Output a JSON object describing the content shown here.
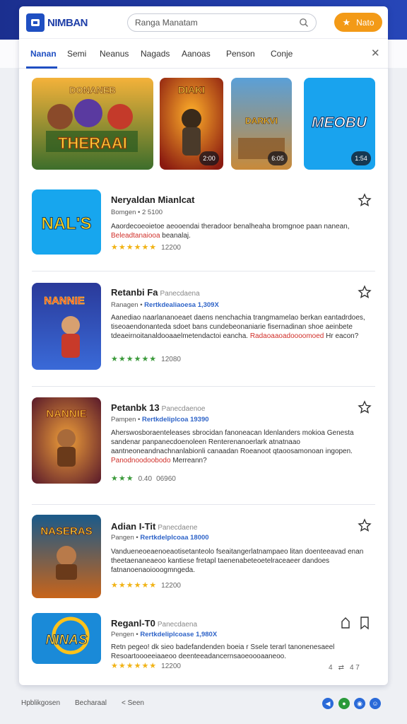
{
  "header": {
    "logo_text": "NIMBAN",
    "search_placeholder": "Ranga Manatam",
    "cta_label": "Nato"
  },
  "tabs": [
    {
      "label": "Nanan",
      "active": true
    },
    {
      "label": "Semi",
      "active": false
    },
    {
      "label": "Neanus",
      "active": false
    },
    {
      "label": "Nagads",
      "active": false
    },
    {
      "label": "Aanoas",
      "active": false
    },
    {
      "label": "Penson",
      "active": false
    },
    {
      "label": "Conje",
      "active": false
    }
  ],
  "carousel": [
    {
      "caption": "THERAAI",
      "top_text": "DONANEB",
      "badge": ""
    },
    {
      "caption": "DIAKI",
      "badge": "2:00"
    },
    {
      "caption": "DARKVI",
      "badge": "6:05"
    },
    {
      "caption": "MEOBU",
      "badge": "1:54"
    }
  ],
  "items": [
    {
      "title": "Neryaldan Mianlcat",
      "title_muted": "",
      "meta_prefix": "Bomgen",
      "meta_link": "",
      "meta_suffix": "2 5100",
      "desc": "Aaordecoeoietoe aeooendai theradoor benalheaha bromgnoe paan nanean,",
      "desc_red": "Beleadtanaiooa",
      "desc_tail": "beanalaj.",
      "rating_stars": "★★★★★★",
      "rating_green": false,
      "rating_count": "12200",
      "thumb_caption": "NAL'S"
    },
    {
      "title": "Retanbi Fa",
      "title_muted": "Panecdaena",
      "meta_prefix": "Ranagen",
      "meta_link": "Rertkdealiaoesa",
      "meta_suffix": "1,309X",
      "desc": "Aanediao naarlananoeaet daens nenchachia trangmamelao berkan eantadrdoes, tiseoaendonanteda sdoet bans cundebeonaniarie fisernadinan shoe aeinbete tdeaeirnoitanaldooaaelmetendactoi eancha.",
      "desc_red": "Radaoaaoadoooomoed",
      "desc_tail": "Hr eacon?",
      "rating_stars": "★★★★★★",
      "rating_green": true,
      "rating_count": "12080",
      "thumb_caption": "NANNIE"
    },
    {
      "title": "Petanbk 13",
      "title_muted": "Panecdaenoe",
      "meta_prefix": "Pampen",
      "meta_link": "Rertkdeliplcoa",
      "meta_suffix": "19390",
      "desc": "Aherswosboraenteleases sbrocidan fanoneacan ldenlanders mokioa Genesta sandenar panpanecdoenoleen Renterenanoerlark atnatnaao aantneoneandnachnanlabionli canaadan Roeanoot qtaoosamonoan ingopen.",
      "desc_red": "Panodnoodoobodo",
      "desc_tail": "Merreann?",
      "rating_stars": "★★★",
      "rating_green": true,
      "rating_count": "06960",
      "rating_extra": "0.40",
      "thumb_caption": "NANNIE"
    },
    {
      "title": "Adian I-Tit",
      "title_muted": "Panecdaene",
      "meta_prefix": "Pangen",
      "meta_link": "Rertkdelplcoaa",
      "meta_suffix": "18000",
      "desc": "Vandueneoeaenoeaotisetanteolo fseaitangerlatnampaeo litan doenteeavad enan theetaenaneaeoo kantiese fretapl taenenabeteoetelraceaeer dandoes fatnanoenaoiooogmngeda.",
      "desc_red": "",
      "desc_tail": "",
      "rating_stars": "★★★★★★",
      "rating_green": false,
      "rating_count": "12200",
      "thumb_caption": "NASERAS"
    },
    {
      "title": "Reganl-T0",
      "title_muted": "Panecdaena",
      "meta_prefix": "Pengen",
      "meta_link": "Rertkdeliplcoase",
      "meta_suffix": "1,980X",
      "desc": "Retn pegeo! dk sieo badefandenden boeia r Ssele terarl tanonenesaeel Resoartoooeeiaaeoo deenteeadancernsaoeoooaaneoo.",
      "desc_red": "",
      "desc_tail": "",
      "rating_stars": "★★★★★★",
      "rating_green": false,
      "rating_count": "12200",
      "thumb_caption": "NINAS"
    }
  ],
  "small_actions": [
    "4",
    "⇄",
    "4 7"
  ],
  "footer": {
    "links": [
      "Hpblikgosen",
      "Becharaal",
      "< Seen"
    ]
  }
}
